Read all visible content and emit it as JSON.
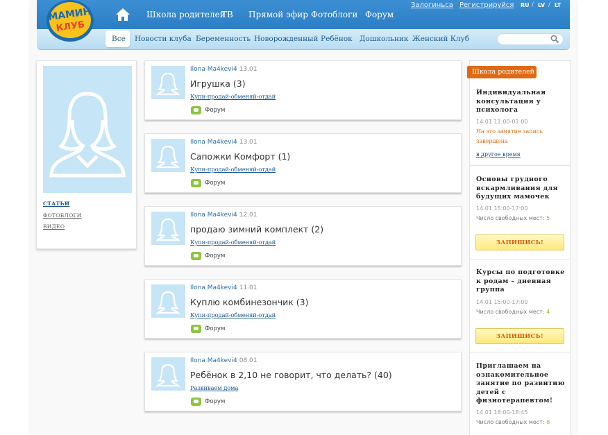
{
  "header": {
    "logo_text": "МАМИН КЛУБ",
    "nav": [
      "Школа родителей",
      "ТВ",
      "Прямой эфир",
      "Фотоблоги",
      "Форум"
    ],
    "login": "Залогиньса",
    "register": "Регистрируйся",
    "languages": [
      "RU",
      "LV",
      "LT"
    ],
    "separator": "/"
  },
  "subnav": {
    "tabs": [
      "Все",
      "Новости клуба",
      "Беременность",
      "Новорожденный",
      "Ребёнок",
      "Дошкольник",
      "Женский Клуб"
    ],
    "active": "Все",
    "search_placeholder": ""
  },
  "profile": {
    "links": [
      "СТАТЬИ",
      "ФОТОБЛОГИ",
      "ВИДЕО"
    ]
  },
  "posts": [
    {
      "author": "Ilona Ma4kevi4",
      "date": "13.01",
      "title": "Игрушка (3)",
      "category": "Купи-продай-обменяй-отдай",
      "forum": "Форум"
    },
    {
      "author": "Ilona Ma4kevi4",
      "date": "13.01",
      "title": "Сапожки Комфорт (1)",
      "category": "Купи-продай-обменяй-отдай",
      "forum": "Форум"
    },
    {
      "author": "Ilona Ma4kevi4",
      "date": "12.01",
      "title": "продаю зимний комплект (2)",
      "category": "Купи-продай-обменяй-отдай",
      "forum": "Форум"
    },
    {
      "author": "Ilona Ma4kevi4",
      "date": "11.01",
      "title": "Куплю комбинезончик (3)",
      "category": "Купи-продай-обменяй-отдай",
      "forum": "Форум"
    },
    {
      "author": "Ilona Ma4kevi4",
      "date": "08.01",
      "title": "Ребёнок в 2,10 не говорит, что делать? (40)",
      "category": "Развиваем дома",
      "forum": "Форум"
    }
  ],
  "sidebar": {
    "tag": "Школа родителей",
    "events": [
      {
        "title": "Индивидуальная консультация у психолога",
        "time": "14.01 11:00-01:00",
        "note": "На это занятие запись завершена",
        "link": "в другое время"
      },
      {
        "title": "Основы грудного вскармливания для будущих мамочек",
        "time": "14.01 15:00-17:00",
        "seats_label": "Число свободных мест:",
        "seats": "5",
        "button": "ЗАПИШИСЬ!"
      },
      {
        "title": "Курсы по подготовке к родам – дневная группа",
        "time": "14.01 15:00-17:00",
        "seats_label": "Число свободных мест:",
        "seats": "4",
        "button": "ЗАПИШИСЬ!"
      },
      {
        "title": "Приглашаем на ознакомительное занятие по развитию детей с физиотерапевтом!",
        "time": "14.01 18:00-18:45",
        "seats_label": "Число свободных мест:",
        "seats": "8"
      }
    ]
  },
  "colors": {
    "header_blue": "#3d8fd4",
    "accent_orange": "#e06a14",
    "avatar_blue": "#c6e5f6",
    "forum_green": "#8cc63f"
  }
}
